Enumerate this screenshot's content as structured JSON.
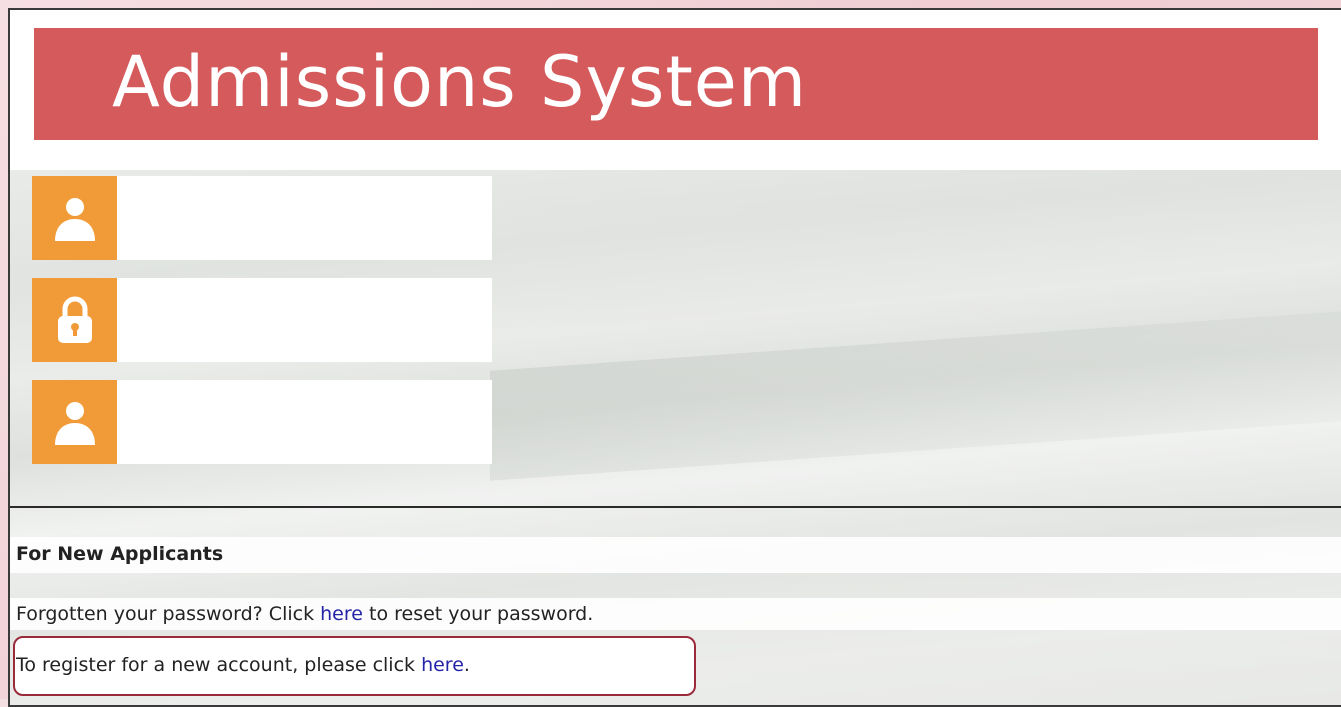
{
  "header": {
    "title": "Admissions System"
  },
  "login": {
    "fields": [
      {
        "icon": "user-icon",
        "value": ""
      },
      {
        "icon": "lock-icon",
        "value": ""
      },
      {
        "icon": "user-icon",
        "value": ""
      }
    ]
  },
  "info": {
    "heading": "For New Applicants",
    "forgot_prefix": "Forgotten your password? Click ",
    "forgot_link": "here",
    "forgot_suffix": " to reset your password.",
    "register_prefix": "To register for a new account, please click ",
    "register_link": "here",
    "register_suffix": "."
  },
  "colors": {
    "banner": "#d55a5c",
    "icon_bg": "#f19b38",
    "link": "#2424a8",
    "highlight_border": "#9a2b3b"
  }
}
